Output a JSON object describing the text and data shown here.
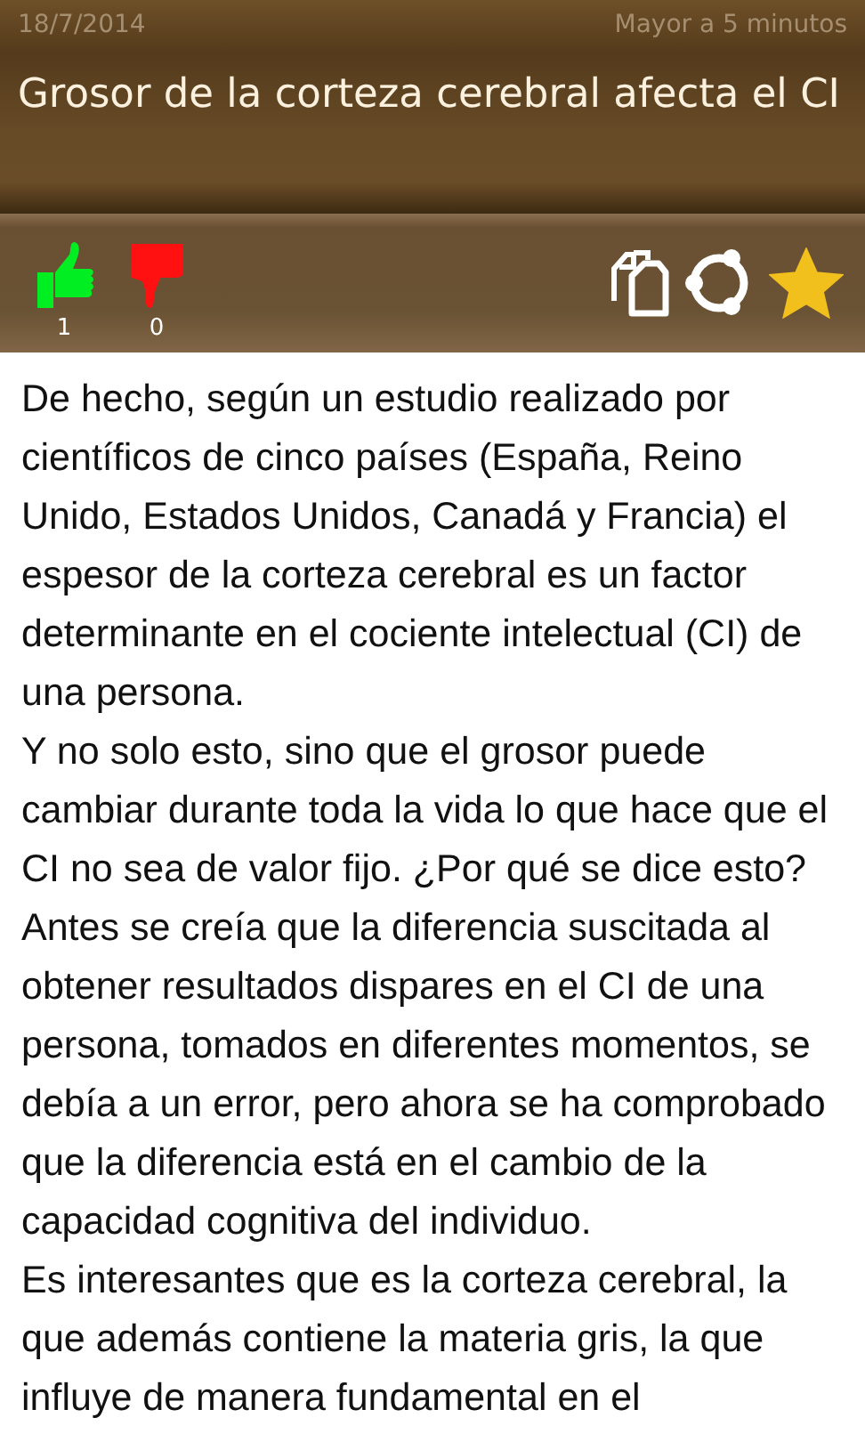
{
  "header": {
    "date": "18/7/2014",
    "reading_time": "Mayor a 5 minutos",
    "title": "Grosor de la corteza cerebral afecta el CI"
  },
  "toolbar": {
    "likes": "1",
    "dislikes": "0",
    "favorite": true
  },
  "paragraphs": [
    "De hecho, según un estudio realizado por científicos de cinco países (España, Reino Unido, Estados Unidos, Canadá y Francia) el espesor de la corteza cerebral es un factor determinante en el cociente intelectual (CI) de una persona.",
    "Y no solo esto, sino que el grosor puede cambiar durante toda la vida lo que hace que el CI no sea de valor fijo. ¿Por qué se dice esto?",
    "Antes se creía que la diferencia suscitada al obtener resultados dispares en el CI de una persona, tomados en diferentes momentos, se debía a un error, pero ahora se ha comprobado que la diferencia está en el cambio de la capacidad cognitiva del individuo.",
    "Es interesantes que es la corteza cerebral, la que además contiene la materia gris, la que influye de manera fundamental en el"
  ]
}
